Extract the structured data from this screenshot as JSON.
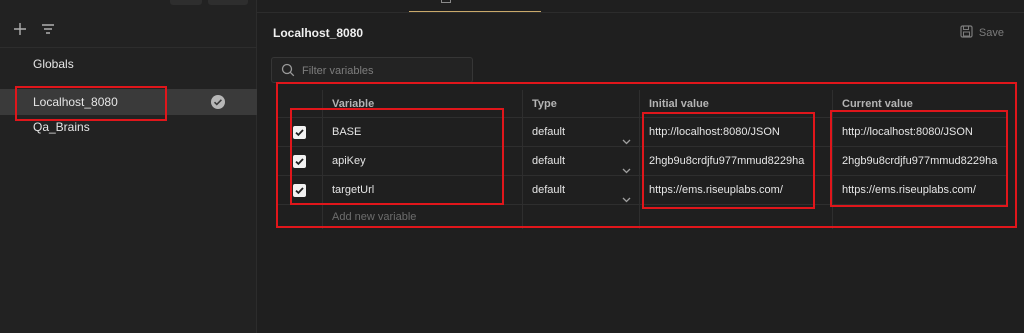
{
  "sidebar": {
    "items": [
      {
        "label": "Globals"
      },
      {
        "label": "Localhost_8080",
        "active": true
      },
      {
        "label": "Qa_Brains"
      }
    ]
  },
  "main": {
    "title": "Localhost_8080",
    "save_label": "Save",
    "filter_placeholder": "Filter variables"
  },
  "table": {
    "headers": {
      "variable": "Variable",
      "type": "Type",
      "initial": "Initial value",
      "current": "Current value"
    },
    "rows": [
      {
        "checked": true,
        "variable": "BASE",
        "type": "default",
        "initial": "http://localhost:8080/JSON",
        "current": "http://localhost:8080/JSON"
      },
      {
        "checked": true,
        "variable": "apiKey",
        "type": "default",
        "initial": "2hgb9u8crdjfu977mmud8229ha",
        "current": "2hgb9u8crdjfu977mmud8229ha"
      },
      {
        "checked": true,
        "variable": "targetUrl",
        "type": "default",
        "initial": "https://ems.riseuplabs.com/",
        "current": "https://ems.riseuplabs.com/"
      }
    ],
    "add_placeholder": "Add new variable"
  },
  "colors": {
    "annotation": "#e0161b",
    "accent_tab": "#c9a96a"
  },
  "icons": [
    "plus-icon",
    "filter-icon",
    "check-circle-icon",
    "save-icon",
    "search-icon",
    "checkbox-icon",
    "chevron-down-icon"
  ]
}
